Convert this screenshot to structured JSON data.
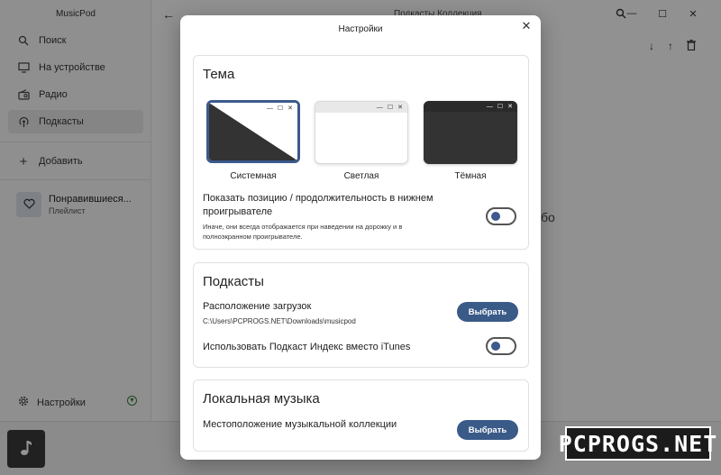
{
  "app": {
    "title": "MusicPod",
    "main_title": "Подкасты Коллекция",
    "bg_text": "бо"
  },
  "sidebar": {
    "items": [
      {
        "label": "Поиск",
        "icon": "search-icon"
      },
      {
        "label": "На устройстве",
        "icon": "computer-icon"
      },
      {
        "label": "Радио",
        "icon": "radio-icon"
      },
      {
        "label": "Подкасты",
        "icon": "podcast-icon",
        "active": true
      }
    ],
    "add_label": "Добавить",
    "playlist": {
      "title": "Понравившиеся...",
      "subtitle": "Плейлист"
    },
    "settings_label": "Настройки"
  },
  "dialog": {
    "title": "Настройки",
    "theme": {
      "heading": "Тема",
      "options": [
        {
          "label": "Системная",
          "selected": true
        },
        {
          "label": "Светлая",
          "selected": false
        },
        {
          "label": "Тёмная",
          "selected": false
        }
      ],
      "show_position_label": "Показать позицию / продолжительность в нижнем проигрывателе",
      "show_position_sub": "Иначе, они всегда отображается при наведении на дорожку и в полноэкранном проигрывателе.",
      "show_position_enabled": false
    },
    "podcasts": {
      "heading": "Подкасты",
      "download_label": "Расположение загрузок",
      "download_path": "C:\\Users\\PCPROGS.NET\\Downloads\\musicpod",
      "choose_label": "Выбрать",
      "podcast_index_label": "Использовать Подкаст Индекс вместо iTunes",
      "podcast_index_enabled": false
    },
    "local_music": {
      "heading": "Локальная музыка",
      "collection_label": "Местоположение музыкальной коллекции",
      "choose_label": "Выбрать"
    }
  },
  "watermark": "PCPROGS.NET",
  "colors": {
    "accent": "#3a5a88",
    "overlay": "rgba(0,0,0,0.42)",
    "selected_border": "#3c5a8c"
  }
}
